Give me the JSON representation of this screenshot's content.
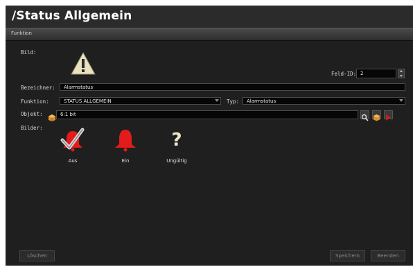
{
  "window": {
    "title": "/Status Allgemein"
  },
  "section": {
    "label": "Funktion"
  },
  "labels": {
    "bild": "Bild:",
    "bezeichner": "Bezeichner:",
    "funktion": "Funktion:",
    "typ": "Typ:",
    "objekt": "Objekt:",
    "bilder": "Bilder:",
    "feld_id": "Feld-ID:"
  },
  "fields": {
    "feld_id_value": "2",
    "bezeichner_value": "Alarmstatus",
    "funktion_value": "STATUS ALLGEMEIN",
    "typ_value": "Alarmstatus",
    "objekt_value": "6:1 bit"
  },
  "images": [
    {
      "icon": "bell-checked-icon",
      "label": "Aus"
    },
    {
      "icon": "bell-red-icon",
      "label": "Ein"
    },
    {
      "icon": "question-icon",
      "label": "Ungültig"
    }
  ],
  "buttons": {
    "delete": "Löschen",
    "save": "Speichern",
    "close": "Beenden"
  },
  "colors": {
    "background": "#1f1f1f",
    "field": "#060606",
    "alarm_red": "#e31b1b",
    "warning_yellow": "#e9e2bf"
  }
}
